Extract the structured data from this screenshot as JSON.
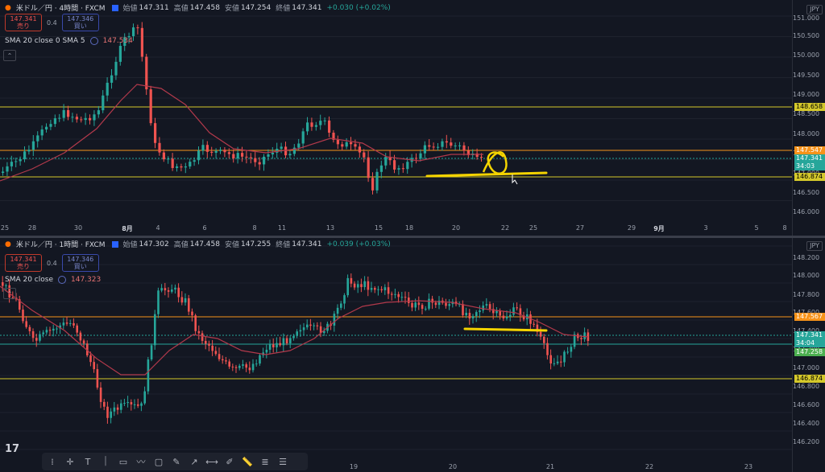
{
  "top_pane": {
    "symbol": "米ドル／円 · 4時間 · FXCM",
    "ohlc": {
      "open_label": "始値",
      "open": "147.311",
      "high_label": "高値",
      "high": "147.458",
      "low_label": "安値",
      "low": "147.254",
      "close_label": "終値",
      "close": "147.341",
      "change": "+0.030 (+0.02%)"
    },
    "sell_price": "147.341",
    "sell_label": "売り",
    "spread": "0.4",
    "buy_price": "147.346",
    "buy_label": "買い",
    "sma_label": "SMA 20 close 0 SMA 5",
    "sma_value": "147.534",
    "currency": "JPY",
    "price_ticks": [
      "151.000",
      "150.500",
      "150.000",
      "149.500",
      "149.000",
      "148.500",
      "148.000",
      "147.500",
      "147.000",
      "146.500",
      "146.000"
    ],
    "badges": {
      "yellow_top": "148.658",
      "orange": "147.547",
      "price": "147.341",
      "countdown": "34:03",
      "yellow_bottom": "146.874"
    },
    "time_ticks": [
      "25",
      "28",
      "30",
      "8月",
      "4",
      "6",
      "8",
      "11",
      "13",
      "15",
      "18",
      "20",
      "22",
      "25",
      "27",
      "29",
      "9月",
      "3",
      "5",
      "8"
    ],
    "colors": {
      "up": "#26a69a",
      "down": "#ef5350",
      "sma": "#b2394b",
      "yellow": "#d4c82b",
      "orange": "#f7931a",
      "annotation": "#f5d400"
    }
  },
  "bottom_pane": {
    "symbol": "米ドル／円 · 1時間 · FXCM",
    "ohlc": {
      "open_label": "始値",
      "open": "147.302",
      "high_label": "高値",
      "high": "147.458",
      "low_label": "安値",
      "low": "147.255",
      "close_label": "終値",
      "close": "147.341",
      "change": "+0.039 (+0.03%)"
    },
    "sell_price": "147.341",
    "sell_label": "売り",
    "spread": "0.4",
    "buy_price": "147.346",
    "buy_label": "買い",
    "sma_label": "SMA 20 close",
    "sma_value": "147.323",
    "currency": "JPY",
    "price_ticks": [
      "148.200",
      "148.000",
      "147.800",
      "147.600",
      "147.400",
      "147.200",
      "147.000",
      "146.800",
      "146.600",
      "146.400",
      "146.200"
    ],
    "badges": {
      "orange": "147.567",
      "price": "147.341",
      "countdown": "34:04",
      "green": "147.258",
      "yellow": "146.874"
    },
    "time_ticks": [
      "19",
      "20",
      "21",
      "22",
      "23"
    ]
  },
  "toolbar": {
    "tools": [
      "drag-handle",
      "crosshair",
      "text",
      "vertical-line",
      "rectangle",
      "path",
      "comment",
      "brush",
      "arrow",
      "horizontal-line",
      "pen",
      "ruler",
      "fib",
      "pattern"
    ]
  },
  "logo": "17"
}
